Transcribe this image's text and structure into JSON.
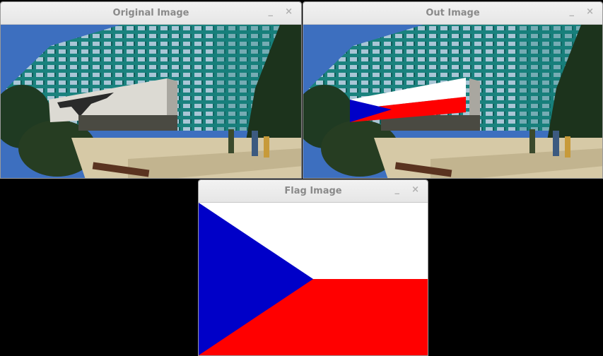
{
  "windows": {
    "original": {
      "title": "Original Image"
    },
    "out": {
      "title": "Out Image"
    },
    "flag": {
      "title": "Flag Image"
    }
  },
  "controls": {
    "minimize": "_",
    "close": "×"
  },
  "colors": {
    "flag_blue": "#0000c8",
    "flag_white": "#ffffff",
    "flag_red": "#ff0000",
    "building_teal": "#1d8a86",
    "sky": "#3d6fbf",
    "pavement": "#d6c9a6"
  },
  "icons": [
    "minimize-icon",
    "close-icon"
  ]
}
